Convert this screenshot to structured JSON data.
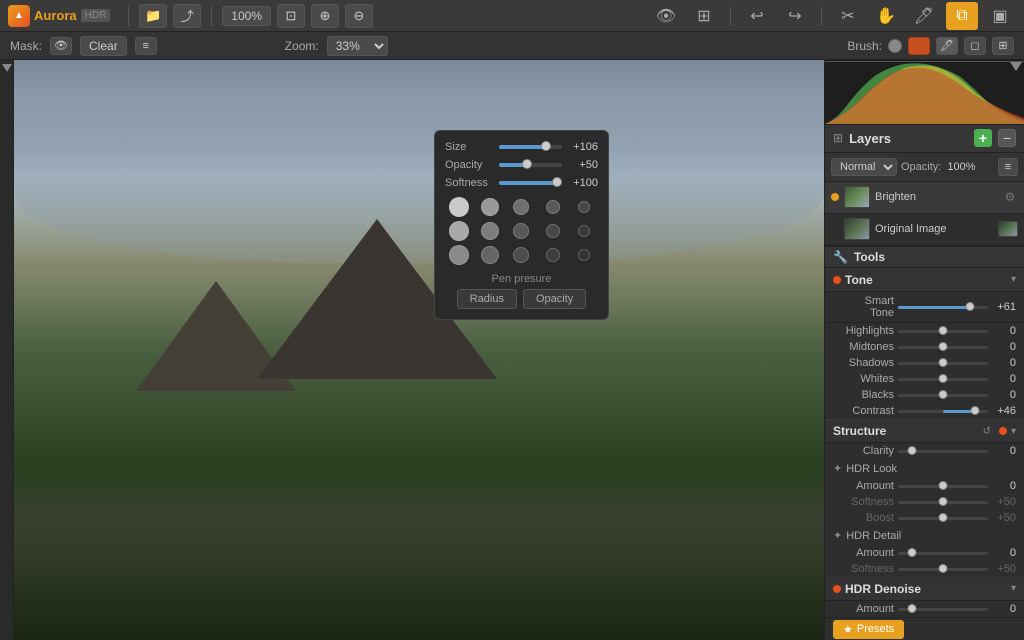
{
  "app": {
    "name": "Aurora",
    "hdr_badge": "HDR",
    "version": ""
  },
  "top_toolbar": {
    "zoom_percent": "100%",
    "zoom_in_label": "+",
    "zoom_out_label": "−",
    "open_label": "📁",
    "share_label": "⤴"
  },
  "mask_bar": {
    "mask_label": "Mask:",
    "clear_label": "Clear",
    "zoom_label": "Zoom:",
    "zoom_value": "33%",
    "brush_label": "Brush:"
  },
  "brush_popup": {
    "size_label": "Size",
    "size_value": "+106",
    "opacity_label": "Opacity",
    "opacity_value": "+50",
    "softness_label": "Softness",
    "softness_value": "+100",
    "pen_pressure_label": "Pen presure",
    "radius_btn": "Radius",
    "opacity_btn": "Opacity"
  },
  "layers": {
    "section_title": "Layers",
    "blend_mode": "Normal",
    "opacity_label": "Opacity:",
    "opacity_value": "100%",
    "items": [
      {
        "name": "Brighten",
        "active": true
      },
      {
        "name": "Original Image",
        "active": false
      }
    ]
  },
  "tools": {
    "section_title": "Tools"
  },
  "tone": {
    "section_title": "Tone",
    "smart_tone_label": "Smart Tone",
    "smart_tone_value": "+61",
    "highlights_label": "Highlights",
    "highlights_value": "0",
    "midtones_label": "Midtones",
    "midtones_value": "0",
    "shadows_label": "Shadows",
    "shadows_value": "0",
    "whites_label": "Whites",
    "whites_value": "0",
    "blacks_label": "Blacks",
    "blacks_value": "0",
    "contrast_label": "Contrast",
    "contrast_value": "+46"
  },
  "structure": {
    "section_title": "Structure",
    "clarity_label": "Clarity",
    "clarity_value": "0",
    "hdr_look_label": "HDR Look",
    "amount_label": "Amount",
    "amount_value": "0",
    "softness_label": "Softness",
    "softness_value": "+50",
    "boost_label": "Boost",
    "boost_value": "+50",
    "hdr_detail_label": "HDR Detail",
    "detail_amount_label": "Amount",
    "detail_amount_value": "0",
    "detail_softness_label": "Softness",
    "detail_softness_value": "+50"
  },
  "hdr_denoise": {
    "section_title": "HDR Denoise",
    "amount_label": "Amount",
    "amount_value": "0"
  },
  "presets": {
    "btn_label": "Presets"
  }
}
